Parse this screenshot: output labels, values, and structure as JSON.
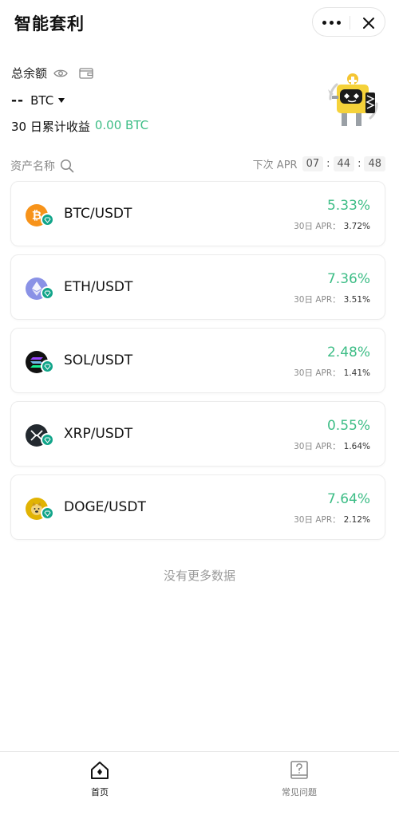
{
  "header": {
    "title": "智能套利",
    "more_icon": "more-dots-icon",
    "close_icon": "close-icon"
  },
  "balance": {
    "label": "总余额",
    "value": "--",
    "unit": "BTC",
    "earnings_label": "30 日累计收益",
    "earnings_value": "0.00 BTC"
  },
  "assets": {
    "header_label": "资产名称",
    "next_apr_label": "下次 APR",
    "countdown": [
      "07",
      "44",
      "48"
    ],
    "items": [
      {
        "pair": "BTC/USDT",
        "rate": "5.33%",
        "apr_label": "30日 APR：",
        "apr_value": "3.72%",
        "coin": "bitcoin-icon",
        "color": "#f7931a"
      },
      {
        "pair": "ETH/USDT",
        "rate": "7.36%",
        "apr_label": "30日 APR：",
        "apr_value": "3.51%",
        "coin": "ethereum-icon",
        "color": "#8a92e6"
      },
      {
        "pair": "SOL/USDT",
        "rate": "2.48%",
        "apr_label": "30日 APR：",
        "apr_value": "1.41%",
        "coin": "solana-icon",
        "color": "#111111"
      },
      {
        "pair": "XRP/USDT",
        "rate": "0.55%",
        "apr_label": "30日 APR：",
        "apr_value": "1.64%",
        "coin": "xrp-icon",
        "color": "#23292f"
      },
      {
        "pair": "DOGE/USDT",
        "rate": "7.64%",
        "apr_label": "30日 APR：",
        "apr_value": "2.12%",
        "coin": "doge-icon",
        "color": "#e1b303"
      }
    ],
    "no_more": "没有更多数据"
  },
  "tabs": [
    {
      "label": "首页",
      "icon": "home-icon",
      "active": true
    },
    {
      "label": "常见问题",
      "icon": "faq-icon",
      "active": false
    }
  ],
  "colors": {
    "accent_green": "#3dbd86",
    "badge_teal": "#12a58a"
  }
}
